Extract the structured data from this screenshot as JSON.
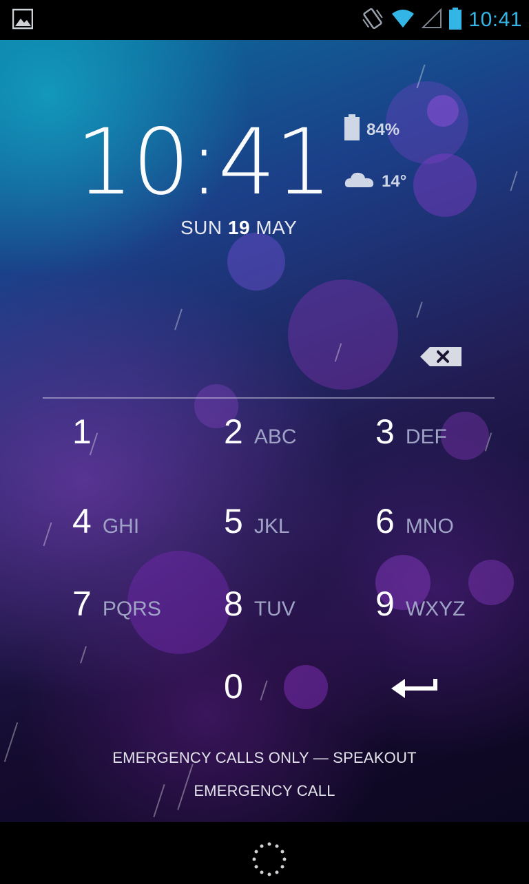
{
  "status_bar": {
    "time": "10:41",
    "icons": [
      "image-notification-icon",
      "vibrate-icon",
      "wifi-icon",
      "signal-icon",
      "battery-icon"
    ],
    "accent_color": "#33b5e5"
  },
  "lockscreen": {
    "clock": {
      "hours": "10",
      "separator": ":",
      "minutes": "41"
    },
    "date": {
      "day": "SUN",
      "date_num": "19",
      "month": "MAY"
    },
    "widgets": {
      "battery": {
        "icon": "battery-icon",
        "value": "84%"
      },
      "weather": {
        "icon": "cloud-icon",
        "value": "14°"
      }
    }
  },
  "keypad": {
    "keys": [
      {
        "num": "1",
        "letters": ""
      },
      {
        "num": "2",
        "letters": "ABC"
      },
      {
        "num": "3",
        "letters": "DEF"
      },
      {
        "num": "4",
        "letters": "GHI"
      },
      {
        "num": "5",
        "letters": "JKL"
      },
      {
        "num": "6",
        "letters": "MNO"
      },
      {
        "num": "7",
        "letters": "PQRS"
      },
      {
        "num": "8",
        "letters": "TUV"
      },
      {
        "num": "9",
        "letters": "WXYZ"
      },
      {
        "num": "0",
        "letters": ""
      }
    ],
    "enter_icon": "enter-arrow-icon",
    "backspace_icon": "backspace-icon"
  },
  "footer": {
    "carrier_line": "EMERGENCY CALLS ONLY — SPEAKOUT",
    "emergency_button": "EMERGENCY CALL"
  },
  "nav_bar": {
    "indicator_icon": "loading-dots-icon"
  }
}
